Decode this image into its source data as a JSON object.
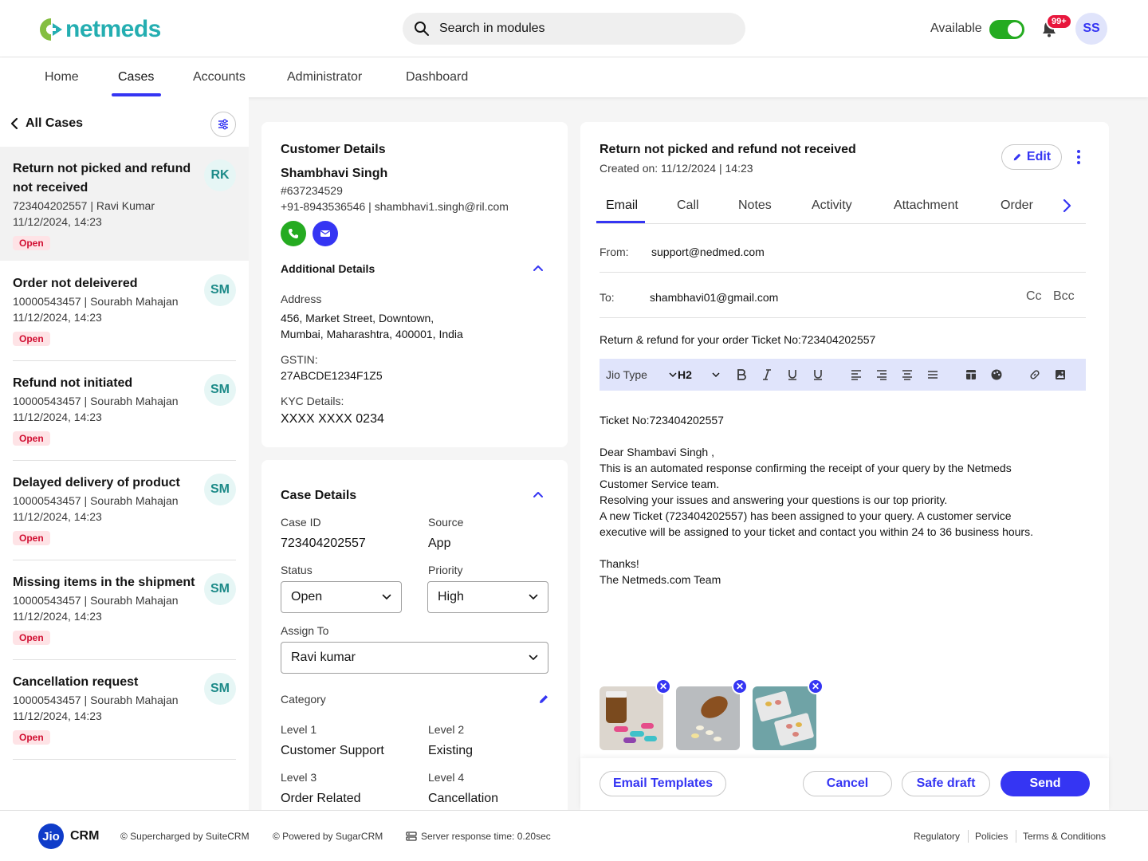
{
  "header": {
    "logo_text": "netmeds",
    "search_placeholder": "Search in modules",
    "availability_label": "Available",
    "availability_on": true,
    "notification_count": "99+",
    "user_initials": "SS"
  },
  "nav": {
    "items": [
      "Home",
      "Cases",
      "Accounts",
      "Administrator",
      "Dashboard"
    ],
    "active": "Cases"
  },
  "sidebar": {
    "title": "All Cases",
    "cases": [
      {
        "title": "Return not picked and refund not received",
        "meta1": "723404202557 | Ravi Kumar",
        "meta2": "11/12/2024, 14:23",
        "status": "Open",
        "initials": "RK"
      },
      {
        "title": "Order not deleivered",
        "meta1": "10000543457 | Sourabh Mahajan",
        "meta2": "11/12/2024, 14:23",
        "status": "Open",
        "initials": "SM"
      },
      {
        "title": "Refund not initiated",
        "meta1": "10000543457 | Sourabh Mahajan",
        "meta2": "11/12/2024, 14:23",
        "status": "Open",
        "initials": "SM"
      },
      {
        "title": "Delayed delivery of product",
        "meta1": "10000543457 | Sourabh Mahajan",
        "meta2": "11/12/2024, 14:23",
        "status": "Open",
        "initials": "SM"
      },
      {
        "title": "Missing items in the shipment",
        "meta1": "10000543457 | Sourabh Mahajan",
        "meta2": "11/12/2024, 14:23",
        "status": "Open",
        "initials": "SM"
      },
      {
        "title": "Cancellation request",
        "meta1": "10000543457 | Sourabh Mahajan",
        "meta2": "11/12/2024, 14:23",
        "status": "Open",
        "initials": "SM"
      }
    ]
  },
  "customer": {
    "heading": "Customer Details",
    "name": "Shambhavi Singh",
    "id": "#637234529",
    "contact": "+91-8943536546 | shambhavi1.singh@ril.com",
    "additional_heading": "Additional Details",
    "address_label": "Address",
    "address_line1": "456, Market Street, Downtown,",
    "address_line2": "Mumbai, Maharashtra, 400001, India",
    "gstin_label": "GSTIN:",
    "gstin": "27ABCDE1234F1Z5",
    "kyc_label": "KYC Details:",
    "kyc": "XXXX XXXX 0234"
  },
  "case_details": {
    "heading": "Case Details",
    "case_id_label": "Case ID",
    "case_id": "723404202557",
    "source_label": "Source",
    "source": "App",
    "status_label": "Status",
    "status": "Open",
    "priority_label": "Priority",
    "priority": "High",
    "assign_label": "Assign To",
    "assign": "Ravi kumar",
    "category_label": "Category",
    "level1_label": "Level 1",
    "level1": "Customer Support",
    "level2_label": "Level 2",
    "level2": "Existing",
    "level3_label": "Level 3",
    "level3": "Order Related",
    "level4_label": "Level 4",
    "level4": "Cancellation"
  },
  "email_panel": {
    "title": "Return not picked and refund not received",
    "created": "Created on: 11/12/2024 | 14:23",
    "edit_label": "Edit",
    "tabs": [
      "Email",
      "Call",
      "Notes",
      "Activity",
      "Attachment",
      "Order"
    ],
    "active_tab": "Email",
    "from_label": "From:",
    "from": "support@nedmed.com",
    "to_label": "To:",
    "to": "shambhavi01@gmail.com",
    "cc": "Cc",
    "bcc": "Bcc",
    "subject": "Return & refund for your order Ticket No:723404202557",
    "font_select": "Jio Type",
    "heading_select": "H2",
    "body": {
      "ticket": "Ticket No:723404202557",
      "greeting": "Dear Shambavi Singh ,",
      "line1": "This is an automated response confirming the receipt of your query by the Netmeds",
      "line2": "Customer Service team.",
      "line3": "Resolving your issues and answering your questions is our top priority.",
      "line4": "A new Ticket (723404202557) has been assigned to your query. A customer service",
      "line5": "executive will be assigned to your ticket and contact you within 24 to 36 business hours.",
      "thanks": "Thanks!",
      "signature": "The Netmeds.com Team"
    },
    "buttons": {
      "templates": "Email Templates",
      "cancel": "Cancel",
      "draft": "Safe draft",
      "send": "Send"
    }
  },
  "footer": {
    "brand_badge": "Jio",
    "brand": "CRM",
    "supercharged": "© Supercharged by SuiteCRM",
    "powered": "© Powered by SugarCRM",
    "server": "Server response time: 0.20sec",
    "links": [
      "Regulatory",
      "Policies",
      "Terms & Conditions"
    ]
  },
  "colors": {
    "accent": "#3535f3",
    "brand_teal": "#24aeb1",
    "status_red": "#d10f32",
    "toggle_green": "#25ab21"
  }
}
